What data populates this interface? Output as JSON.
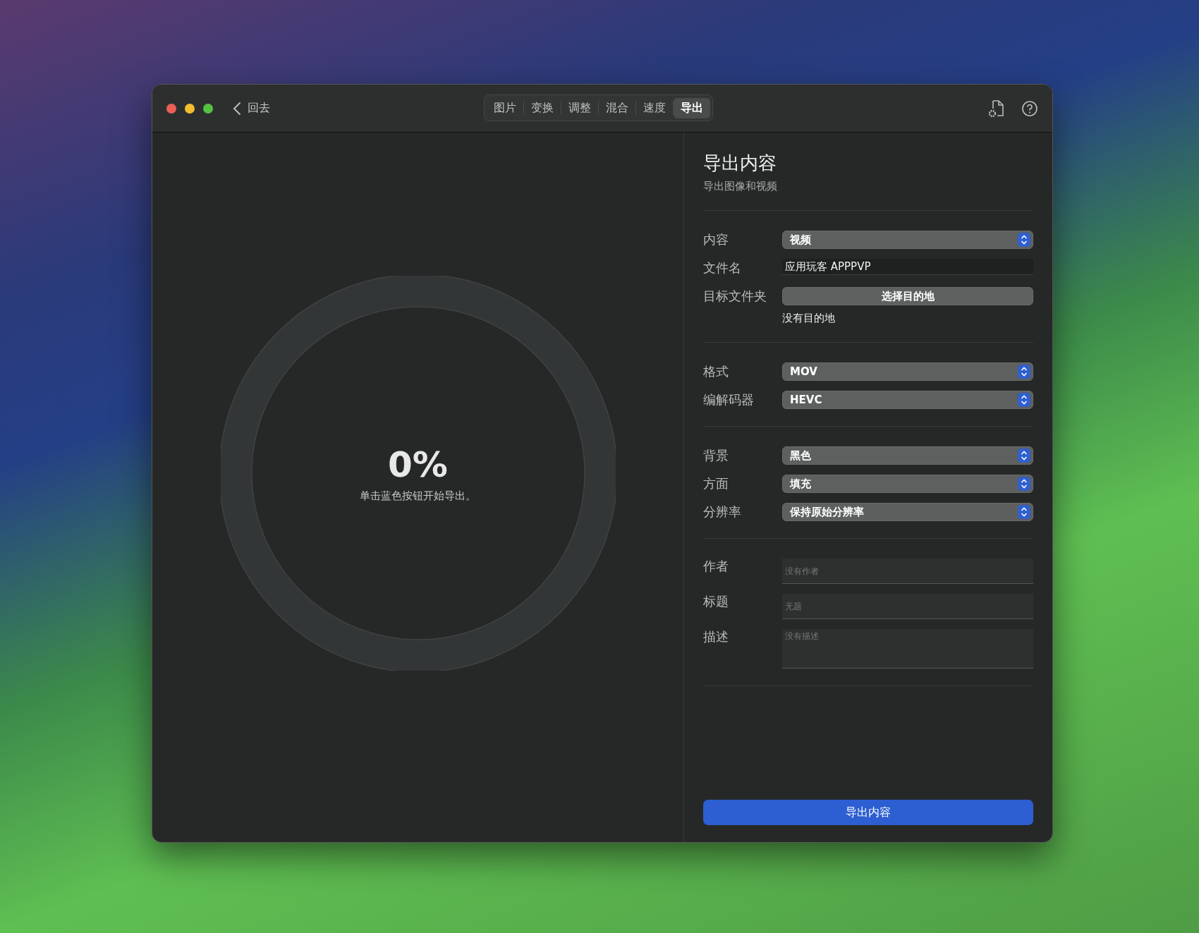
{
  "window": {
    "back_label": "回去"
  },
  "tabs": [
    {
      "label": "图片",
      "selected": false
    },
    {
      "label": "变换",
      "selected": false
    },
    {
      "label": "调整",
      "selected": false
    },
    {
      "label": "混合",
      "selected": false
    },
    {
      "label": "速度",
      "selected": false
    },
    {
      "label": "导出",
      "selected": true
    }
  ],
  "progress": {
    "percent": "0%",
    "hint": "单击蓝色按钮开始导出。"
  },
  "panel": {
    "title": "导出内容",
    "subtitle": "导出图像和视频",
    "groups": [
      {
        "rows": [
          {
            "kind": "select",
            "label": "内容",
            "value": "视频"
          },
          {
            "kind": "text",
            "label": "文件名",
            "value": "应用玩客 APPPVP"
          },
          {
            "kind": "button",
            "label": "目标文件夹",
            "value": "选择目的地",
            "note": "没有目的地"
          }
        ]
      },
      {
        "rows": [
          {
            "kind": "select",
            "label": "格式",
            "value": "MOV"
          },
          {
            "kind": "select",
            "label": "编解码器",
            "value": "HEVC"
          }
        ]
      },
      {
        "rows": [
          {
            "kind": "select",
            "label": "背景",
            "value": "黑色"
          },
          {
            "kind": "select",
            "label": "方面",
            "value": "填充"
          },
          {
            "kind": "select",
            "label": "分辨率",
            "value": "保持原始分辨率"
          }
        ]
      },
      {
        "rows": [
          {
            "kind": "field",
            "label": "作者",
            "placeholder": "没有作者"
          },
          {
            "kind": "field",
            "label": "标题",
            "placeholder": "无题"
          },
          {
            "kind": "area",
            "label": "描述",
            "placeholder": "没有描述"
          }
        ]
      }
    ],
    "export_button": "导出内容"
  }
}
